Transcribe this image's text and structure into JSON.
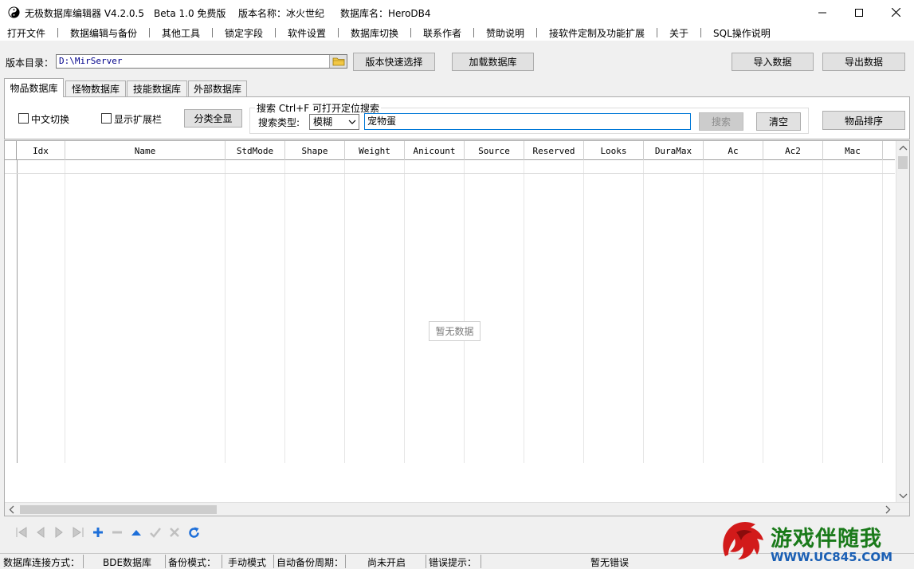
{
  "window": {
    "title_parts": [
      "无极数据库编辑器 V4.2.0.5",
      "Beta 1.0 免费版",
      "版本名称：冰火世纪",
      "数据库名：HeroDB4"
    ]
  },
  "menu": [
    "打开文件",
    "数据编辑与备份",
    "其他工具",
    "锁定字段",
    "软件设置",
    "数据库切换",
    "联系作者",
    "赞助说明",
    "接软件定制及功能扩展",
    "关于",
    "SQL操作说明"
  ],
  "toolbar": {
    "dir_label": "版本目录：",
    "dir_value": "D:\\MirServer",
    "quick_select": "版本快速选择",
    "load_db": "加载数据库",
    "import": "导入数据",
    "export": "导出数据"
  },
  "tabs": [
    "物品数据库",
    "怪物数据库",
    "技能数据库",
    "外部数据库"
  ],
  "filters": {
    "chinese_switch": "中文切换",
    "show_ext": "显示扩展栏",
    "show_all": "分类全显",
    "search_group": "搜索  Ctrl+F 可打开定位搜索",
    "search_type_label": "搜索类型:",
    "search_type_value": "模糊",
    "search_value": "宠物蛋",
    "search_btn": "搜索",
    "clear_btn": "清空",
    "sort_btn": "物品排序"
  },
  "grid": {
    "columns": [
      "Idx",
      "Name",
      "StdMode",
      "Shape",
      "Weight",
      "Anicount",
      "Source",
      "Reserved",
      "Looks",
      "DuraMax",
      "Ac",
      "Ac2",
      "Mac"
    ],
    "empty": "暂无数据"
  },
  "status": [
    "数据库连接方式：",
    "BDE数据库",
    "备份模式：",
    "手动模式",
    "自动备份周期：",
    "尚未开启",
    "错误提示：",
    "暂无错误"
  ],
  "watermark": {
    "text": "游戏伴随我",
    "url": "WWW.UC845.COM"
  },
  "colors": {
    "accent": "#0078d7",
    "nav_blue": "#1e6fd9"
  }
}
